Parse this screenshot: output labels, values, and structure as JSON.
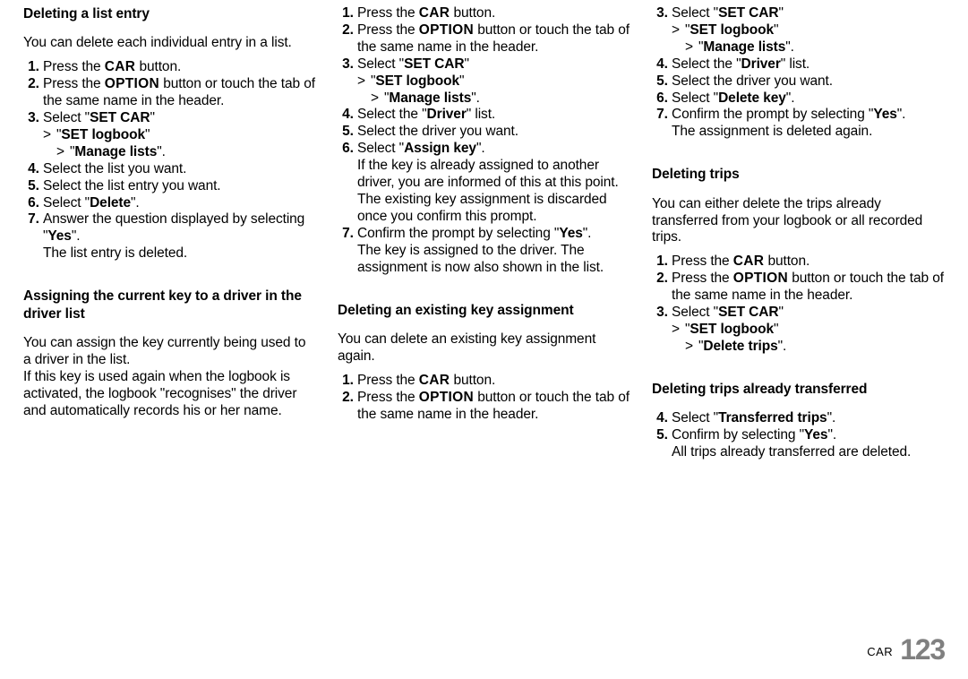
{
  "col1": {
    "h1": "Deleting a list entry",
    "p1": "You can delete each individual entry in a list.",
    "s1_1a": "Press the ",
    "s1_1b": "CAR",
    "s1_1c": " button.",
    "s1_2a": "Press the ",
    "s1_2b": "OPTION",
    "s1_2c": " button or touch the tab of the same name in the header.",
    "s1_3a": "Select \"",
    "s1_3b": "SET CAR",
    "s1_3c": "\"",
    "s1_3s1a": "\"",
    "s1_3s1b": "SET logbook",
    "s1_3s1c": "\"",
    "s1_3s2a": "\"",
    "s1_3s2b": "Manage lists",
    "s1_3s2c": "\".",
    "s1_4": "Select the list you want.",
    "s1_5": "Select the list entry you want.",
    "s1_6a": "Select \"",
    "s1_6b": "Delete",
    "s1_6c": "\".",
    "s1_7a": "Answer the question displayed by selecting \"",
    "s1_7b": "Yes",
    "s1_7c": "\".",
    "s1_7d": "The list entry is deleted.",
    "h2": "Assigning the current key to a driver in the driver list",
    "p2": "You can assign the key currently being used to a driver in the list.",
    "p3": "If this key is used again when the logbook is acti­vated, the logbook \"recognises\" the driver and au­tomatically records his or her name."
  },
  "col2": {
    "s2_1a": "Press the ",
    "s2_1b": "CAR",
    "s2_1c": " button.",
    "s2_2a": "Press the ",
    "s2_2b": "OPTION",
    "s2_2c": " button or touch the tab of the same name in the header.",
    "s2_3a": "Select \"",
    "s2_3b": "SET CAR",
    "s2_3c": "\"",
    "s2_3s1a": "\"",
    "s2_3s1b": "SET logbook",
    "s2_3s1c": "\"",
    "s2_3s2a": "\"",
    "s2_3s2b": "Manage lists",
    "s2_3s2c": "\".",
    "s2_4a": "Select the \"",
    "s2_4b": "Driver",
    "s2_4c": "\" list.",
    "s2_5": "Select the driver you want.",
    "s2_6a": "Select \"",
    "s2_6b": "Assign key",
    "s2_6c": "\".",
    "s2_6d": "If the key is already assigned to another driver, you are informed of this at this point. The exist­ing key assignment is discarded once you con­firm this prompt.",
    "s2_7a": "Confirm the prompt by selecting \"",
    "s2_7b": "Yes",
    "s2_7c": "\".",
    "s2_7d": "The key is assigned to the driver. The assign­ment is now also shown in the list.",
    "h3": "Deleting an existing key assignment",
    "p4": "You can delete an existing key assignment again.",
    "s3_1a": "Press the ",
    "s3_1b": "CAR",
    "s3_1c": " button.",
    "s3_2a": "Press the ",
    "s3_2b": "OPTION",
    "s3_2c": " button or touch the tab of the same name in the header."
  },
  "col3": {
    "s4_3a": "Select \"",
    "s4_3b": "SET CAR",
    "s4_3c": "\"",
    "s4_3s1a": "\"",
    "s4_3s1b": "SET logbook",
    "s4_3s1c": "\"",
    "s4_3s2a": "\"",
    "s4_3s2b": "Manage lists",
    "s4_3s2c": "\".",
    "s4_4a": "Select the \"",
    "s4_4b": "Driver",
    "s4_4c": "\" list.",
    "s4_5": "Select the driver you want.",
    "s4_6a": "Select \"",
    "s4_6b": "Delete key",
    "s4_6c": "\".",
    "s4_7a": "Confirm the prompt by selecting \"",
    "s4_7b": "Yes",
    "s4_7c": "\".",
    "s4_7d": "The assignment is deleted again.",
    "h4": "Deleting trips",
    "p5": "You can either delete the trips already transferred from your logbook or all recorded trips.",
    "s5_1a": "Press the ",
    "s5_1b": "CAR",
    "s5_1c": " button.",
    "s5_2a": "Press the ",
    "s5_2b": "OPTION",
    "s5_2c": " button or touch the tab of the same name in the header.",
    "s5_3a": "Select \"",
    "s5_3b": "SET CAR",
    "s5_3c": "\"",
    "s5_3s1a": "\"",
    "s5_3s1b": "SET logbook",
    "s5_3s1c": "\"",
    "s5_3s2a": "\"",
    "s5_3s2b": "Delete trips",
    "s5_3s2c": "\".",
    "h5": "Deleting trips already transferred",
    "s6_4a": "Select \"",
    "s6_4b": "Transferred trips",
    "s6_4c": "\".",
    "s6_5a": "Confirm by selecting \"",
    "s6_5b": "Yes",
    "s6_5c": "\".",
    "s6_5d": "All trips already transferred are deleted."
  },
  "footer": {
    "section": "CAR",
    "page": "123"
  }
}
